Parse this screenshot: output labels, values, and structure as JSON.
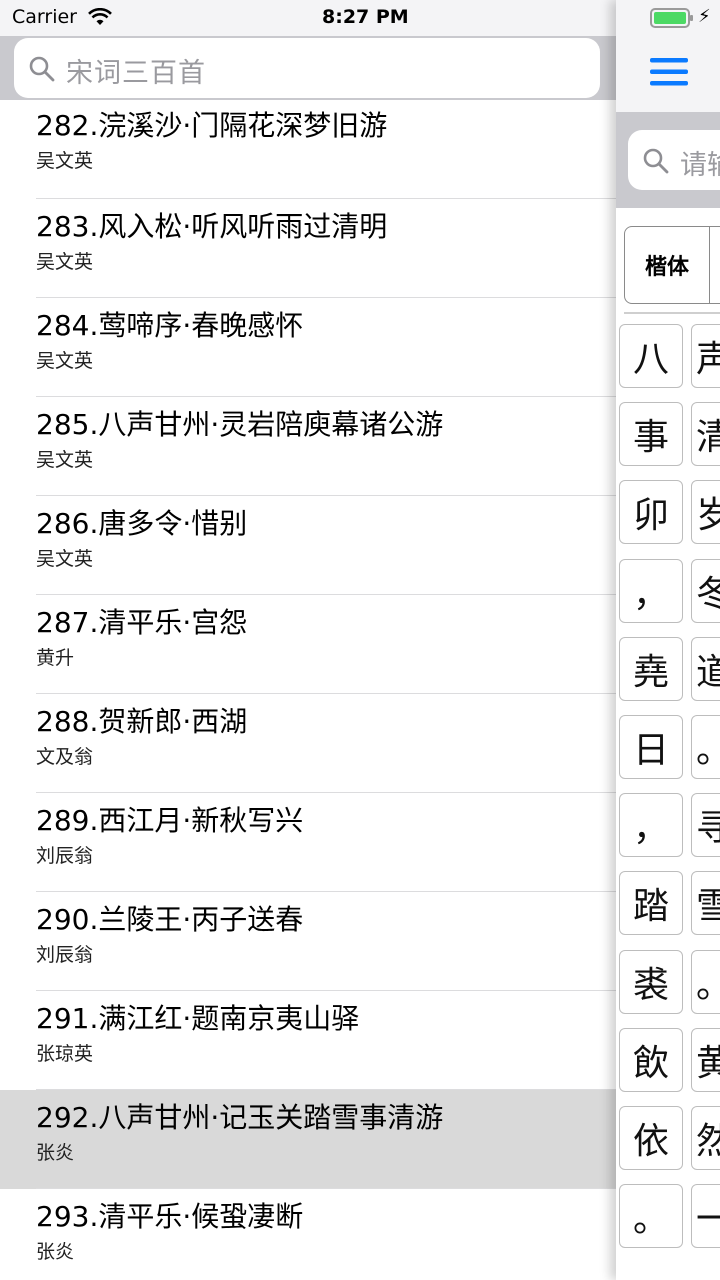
{
  "status": {
    "carrier": "Carrier",
    "time": "8:27 PM"
  },
  "search": {
    "text": "宋词三百首"
  },
  "poems": [
    {
      "title": "282.浣溪沙·门隔花深梦旧游",
      "author": "吴文英"
    },
    {
      "title": "283.风入松·听风听雨过清明",
      "author": "吴文英"
    },
    {
      "title": "284.莺啼序·春晚感怀",
      "author": "吴文英"
    },
    {
      "title": "285.八声甘州·灵岩陪庾幕诸公游",
      "author": "吴文英"
    },
    {
      "title": "286.唐多令·惜别",
      "author": "吴文英"
    },
    {
      "title": "287.清平乐·宫怨",
      "author": "黄升"
    },
    {
      "title": "288.贺新郎·西湖",
      "author": "文及翁"
    },
    {
      "title": "289.西江月·新秋写兴",
      "author": "刘辰翁"
    },
    {
      "title": "290.兰陵王·丙子送春",
      "author": "刘辰翁"
    },
    {
      "title": "291.满江红·题南京夷山驿",
      "author": "张琼英"
    },
    {
      "title": "292.八声甘州·记玉关踏雪事清游",
      "author": "张炎"
    },
    {
      "title": "293.清平乐·候蛩凄断",
      "author": "张炎"
    }
  ],
  "selected_index": 10,
  "drawer": {
    "search_text": "请输",
    "font_tab": "楷体",
    "tiles_left": [
      "八",
      "事",
      "卯",
      "，",
      "堯",
      "日",
      "，",
      "踏",
      "裘",
      "飲",
      "依",
      "。"
    ],
    "tiles_right": [
      "声",
      "清",
      "岁",
      "冬",
      "道",
      "。",
      "寻",
      "雪",
      "。",
      "黄",
      "然",
      "一"
    ]
  },
  "colors": {
    "accent": "#0a7aff",
    "selected_row": "#d9d9d9",
    "battery": "#4cd964"
  }
}
